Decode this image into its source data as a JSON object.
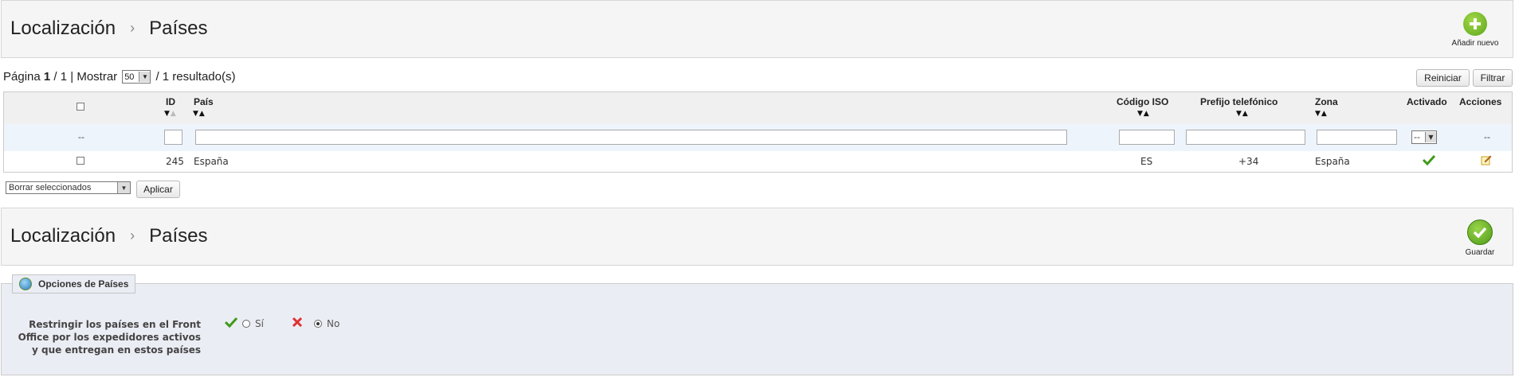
{
  "top_toolbar": {
    "crumb_parent": "Localización",
    "crumb_sep": "›",
    "crumb_current": "Países",
    "add_label": "Añadir nuevo"
  },
  "pagination": {
    "page_word": "Página",
    "page": "1",
    "of": "/ 1",
    "bar": "|",
    "show_word": "Mostrar",
    "per_page": "50",
    "results": "/ 1 resultado(s)"
  },
  "buttons": {
    "reset": "Reiniciar",
    "filter": "Filtrar",
    "apply": "Aplicar"
  },
  "table": {
    "headers": {
      "id": "ID",
      "country": "País",
      "iso": "Código ISO",
      "prefix": "Prefijo telefónico",
      "zone": "Zona",
      "active": "Activado",
      "actions": "Acciones"
    },
    "filter": {
      "checkbox_dash": "--",
      "active_value": "--",
      "actions_dash": "--"
    },
    "rows": [
      {
        "id": "245",
        "country": "España",
        "iso": "ES",
        "prefix": "+34",
        "zone": "España",
        "active": true
      }
    ]
  },
  "bulk_action": {
    "selected": "Borrar seleccionados"
  },
  "bottom_toolbar": {
    "crumb_parent": "Localización",
    "crumb_sep": "›",
    "crumb_current": "Países",
    "save_label": "Guardar"
  },
  "options": {
    "legend": "Opciones de Países",
    "label": "Restringir los países en el Front Office por los expedidores activos y que entregan en estos países",
    "yes_label": "Sí",
    "no_label": "No",
    "selected": "no"
  },
  "colors": {
    "green": "#5ca51b",
    "red": "#e03030",
    "panel": "#ebedf4"
  }
}
